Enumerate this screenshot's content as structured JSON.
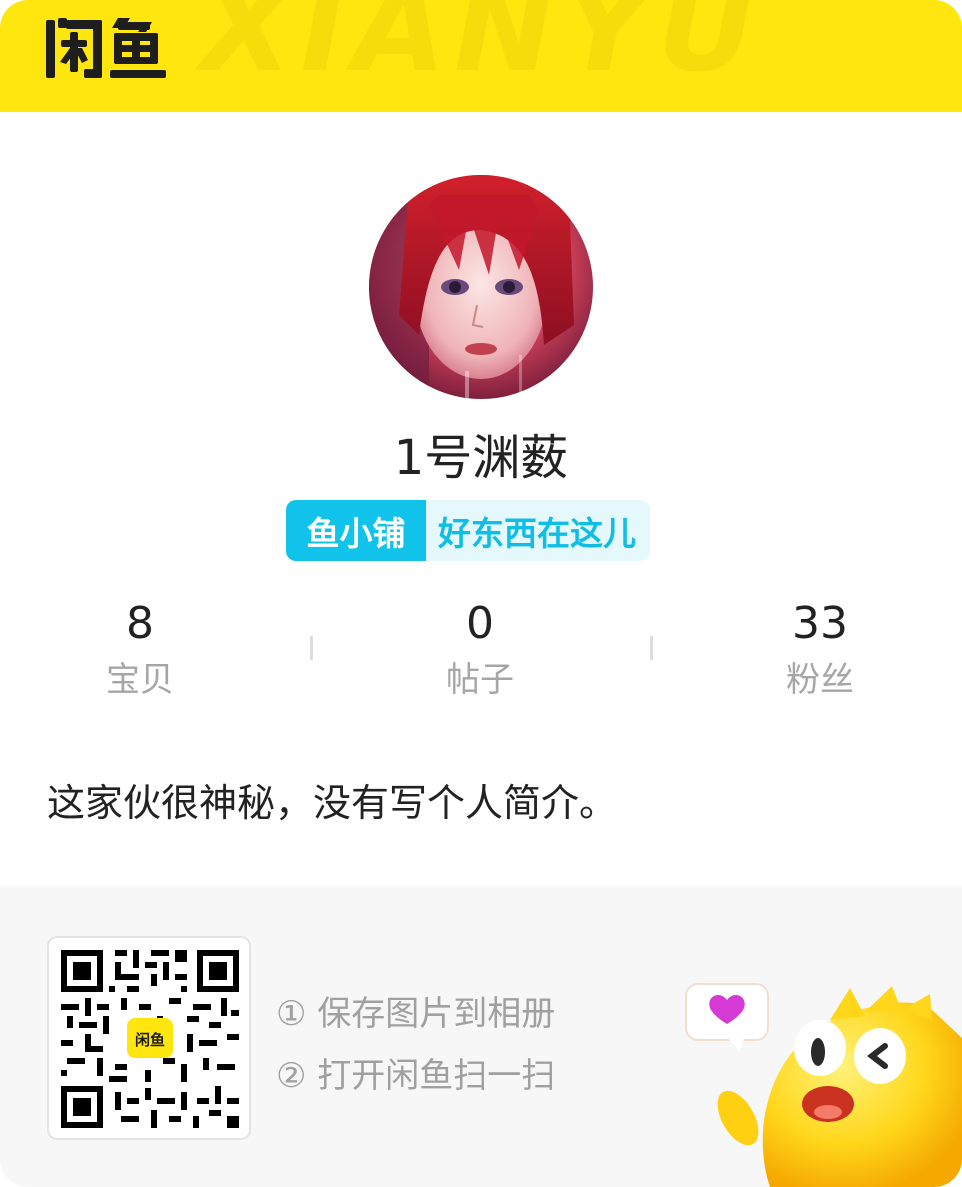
{
  "header": {
    "logo_text": "闲鱼",
    "watermark_text": "XIANYU",
    "background_color": "#ffe60f"
  },
  "profile": {
    "username": "1号渊薮",
    "badge": {
      "tag": "鱼小铺",
      "slogan": "好东西在这儿"
    }
  },
  "stats": [
    {
      "value": "8",
      "label": "宝贝"
    },
    {
      "value": "0",
      "label": "帖子"
    },
    {
      "value": "33",
      "label": "粉丝"
    }
  ],
  "bio": "这家伙很神秘，没有写个人简介。",
  "footer": {
    "qr_logo_text": "闲鱼",
    "steps": [
      "① 保存图片到相册",
      "② 打开闲鱼扫一扫"
    ]
  },
  "colors": {
    "brand_yellow": "#ffe60f",
    "badge_blue": "#11c3ea",
    "badge_light": "#e5f9fd",
    "text_dark": "#222222",
    "text_gray": "#a6a6a6"
  },
  "icons": {
    "qr": "qr-code-icon",
    "mascot": "fish-mascot-icon",
    "heart": "heart-icon"
  }
}
